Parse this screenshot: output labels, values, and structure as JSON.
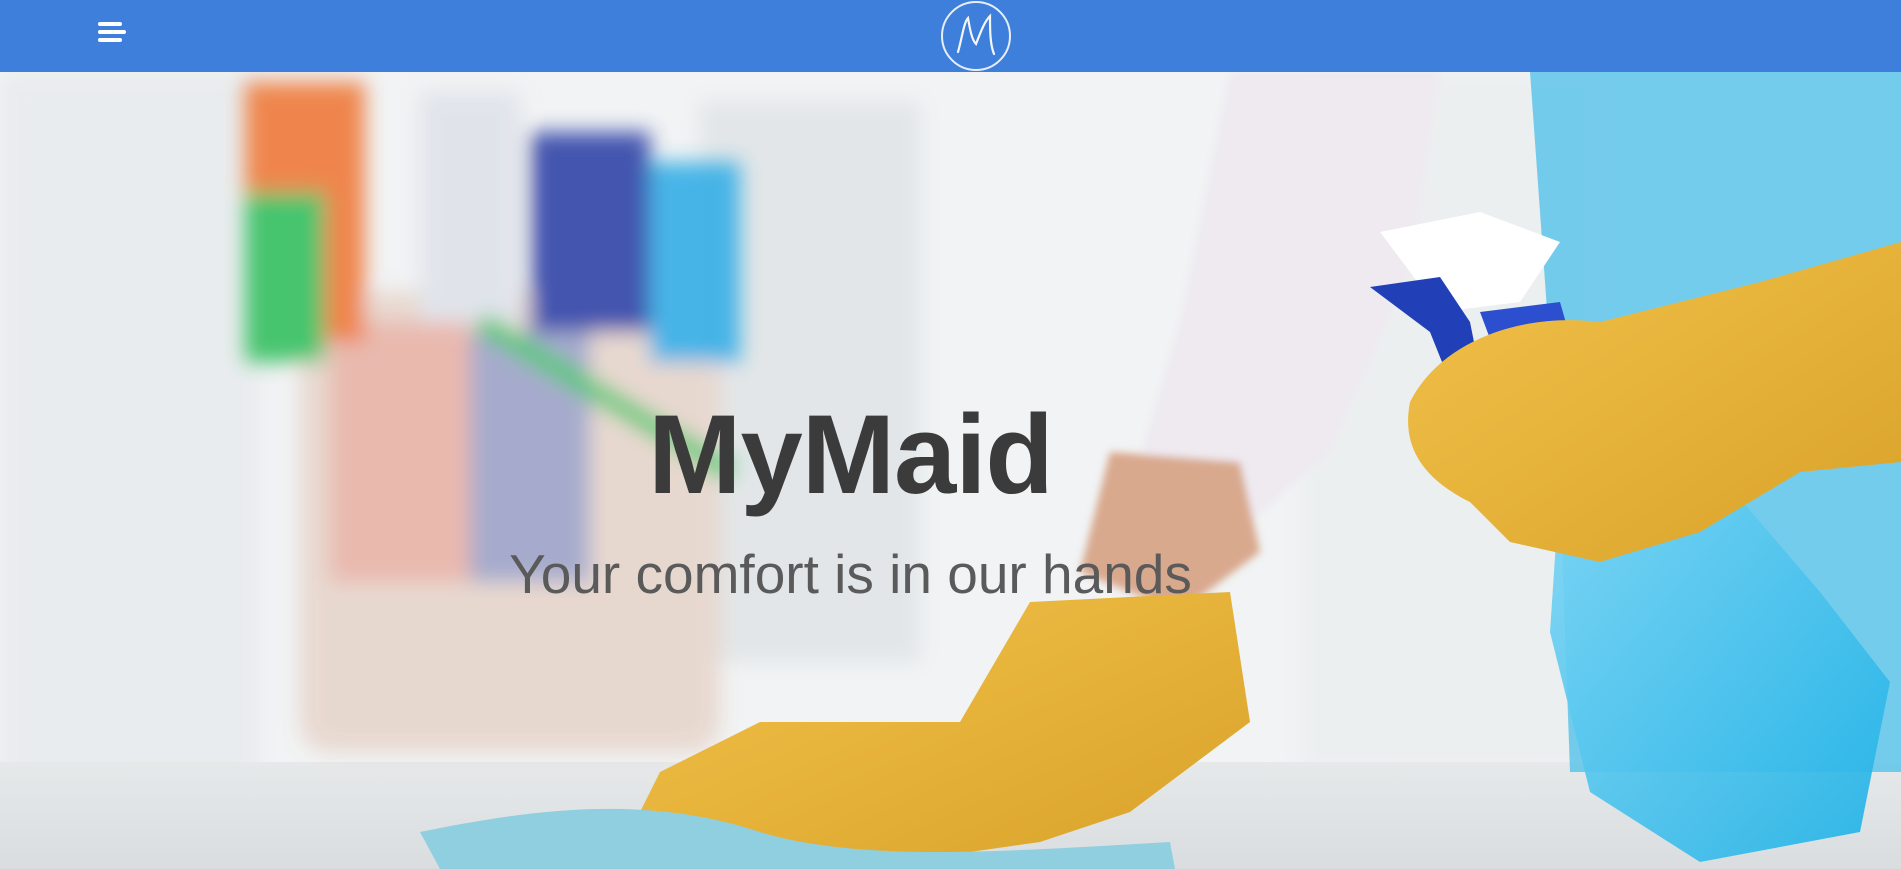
{
  "header": {
    "menu_icon": "hamburger-menu-icon",
    "logo_icon": "mymaid-m-logo-icon",
    "logo_letter": "M"
  },
  "hero": {
    "title": "MyMaid",
    "tagline": "Your comfort is in our hands",
    "background_image": "cleaning-hands-with-gloves-and-spray-bottle"
  },
  "colors": {
    "header_bg": "#3e7fdb",
    "title": "#3b3b3b",
    "tagline": "#5a5a5a"
  }
}
